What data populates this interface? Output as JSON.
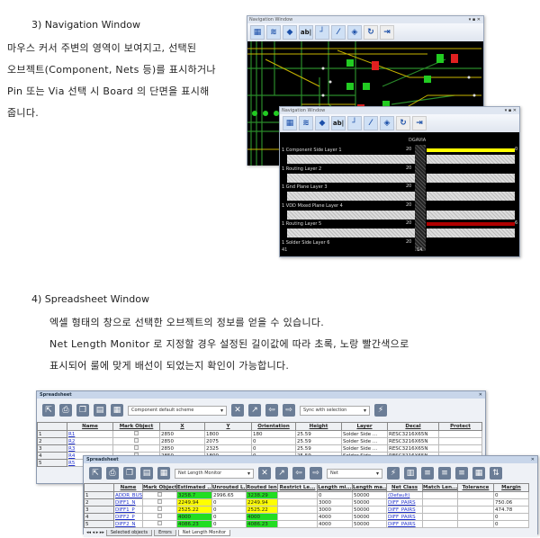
{
  "section3": {
    "heading": "3)   Navigation Window",
    "lines": [
      "마우스 커서 주변의 영역이 보여지고, 선택된",
      "오브젝트(Component, Nets 등)를 표시하거나",
      "Pin 또는 Via 선택 시 Board 의 단면을 표시해",
      "줍니다."
    ]
  },
  "nav_window": {
    "title": "Navigation Window",
    "controls": "▾ ▪ ✕",
    "toolbar_icons": [
      "board-view-icon",
      "layers-view-icon",
      "component-icon",
      "text-label-icon",
      "route-icon",
      "connection-icon",
      "layer-stack-icon",
      "refresh-icon",
      "exit-icon"
    ],
    "toolbar_text_icon": "ab|",
    "via_label": "DGAVIA",
    "layers": [
      {
        "label": "1 Component Side Layer 1",
        "value": "20",
        "bar": "#ffff00",
        "right": "0"
      },
      {
        "label": "1 Routing Layer 2",
        "value": "20",
        "bar": "",
        "right": ""
      },
      {
        "label": "1 Gnd Plane Layer 3",
        "value": "20",
        "bar": "",
        "right": ""
      },
      {
        "label": "1 VDD Mixed Plane Layer 4",
        "value": "20",
        "bar": "",
        "right": ""
      },
      {
        "label": "1 Routing Layer 5",
        "value": "20",
        "bar": "#b00000",
        "right": "6"
      },
      {
        "label": "1 Solder Side Layer 6",
        "value": "20",
        "bar": "",
        "right": ""
      }
    ],
    "footer_left": "41",
    "footer_mid": "14"
  },
  "section4": {
    "heading": "4)   Spreadsheet Window",
    "lines": [
      "엑셀 형태의 창으로 선택한 오브젝트의 정보를 얻을 수 있습니다.",
      "Net Length Monitor 로 지정할 경우 설정된 길이값에 따라 초록, 노랑 빨간색으로",
      "표시되어 룰에 맞게 배선이 되었는지 확인이 가능합니다."
    ]
  },
  "spreadsheet1": {
    "title": "Spreadsheet",
    "scheme": "Component default scheme",
    "sync": "Sync with selection",
    "columns": [
      "",
      "Name",
      "Mark Object",
      "X",
      "Y",
      "Orientation",
      "Height",
      "Layer",
      "Decal",
      "Protect"
    ],
    "rows": [
      [
        "1",
        "R1",
        "",
        "2850",
        "1800",
        "180",
        "25.59",
        "Solder Side ...",
        "RESC3216X65N",
        ""
      ],
      [
        "2",
        "R2",
        "",
        "2850",
        "2075",
        "0",
        "25.59",
        "Solder Side ...",
        "RESC3216X65N",
        ""
      ],
      [
        "3",
        "R3",
        "",
        "2850",
        "2325",
        "0",
        "25.59",
        "Solder Side ...",
        "RESC3216X65N",
        ""
      ],
      [
        "4",
        "R4",
        "",
        "2850",
        "1800",
        "0",
        "25.59",
        "Solder Side ...",
        "RESC3216X65N",
        ""
      ],
      [
        "5",
        "R5",
        "",
        "",
        "",
        "",
        "",
        "",
        "",
        ""
      ]
    ]
  },
  "spreadsheet2": {
    "title": "Spreadsheet",
    "scheme": "Net Length Monitor",
    "filter": "Net",
    "columns": [
      "",
      "Name",
      "Mark Object",
      "Estimated ...",
      "Unrouted L...",
      "Routed len...",
      "Restrict Le...",
      "Length mi...",
      "Length ma...",
      "Net Class",
      "Match Len...",
      "Tolerance",
      "Margin"
    ],
    "rows": [
      [
        "1",
        "ADDR_BUS0",
        "",
        "3258.7",
        "2996.65",
        "3238.29",
        "",
        "0",
        "50000",
        "(Default)",
        "",
        "",
        "0"
      ],
      [
        "2",
        "DIFF1_N",
        "",
        "2249.94",
        "0",
        "2249.94",
        "",
        "3000",
        "50000",
        "DIFF_PAIRS",
        "",
        "",
        "750.06"
      ],
      [
        "3",
        "DIFF1_P",
        "",
        "2525.22",
        "0",
        "2525.22",
        "",
        "3000",
        "50000",
        "DIFF_PAIRS",
        "",
        "",
        "474.78"
      ],
      [
        "4",
        "DIFF2_P",
        "",
        "4000",
        "0",
        "4000",
        "",
        "4000",
        "50000",
        "DIFF_PAIRS",
        "",
        "",
        "0"
      ],
      [
        "5",
        "DIFF2_N",
        "",
        "4086.23",
        "0",
        "4086.23",
        "",
        "4000",
        "50000",
        "DIFF_PAIRS",
        "",
        "",
        "0"
      ]
    ],
    "row_colors": [
      [
        "g",
        "",
        "g"
      ],
      [
        "y",
        "",
        "y"
      ],
      [
        "y",
        "",
        "y"
      ],
      [
        "g",
        "",
        "g"
      ],
      [
        "g",
        "",
        "g"
      ]
    ],
    "tabs": [
      "Selected objects",
      "Errors",
      "Net Length Monitor"
    ],
    "active_tab": 2,
    "status_colors": {
      "ok": "#22dd22",
      "warn": "#ffff00",
      "error": "#ff0000"
    }
  }
}
